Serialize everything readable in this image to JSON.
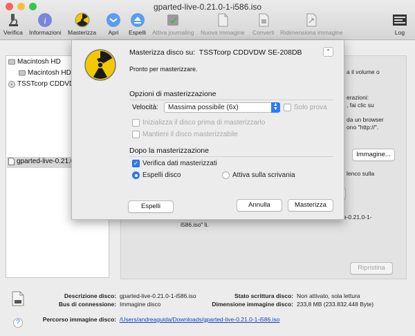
{
  "window": {
    "title": "gparted-live-0.21.0-1-i586.iso"
  },
  "toolbar": {
    "verifica": "Verifica",
    "informazioni": "Informazioni",
    "masterizza": "Masterizza",
    "apri": "Apri",
    "espelli": "Espelli",
    "attiva_journaling": "Attiva journaling",
    "nuova_immagine": "Nuova immagine",
    "converti": "Converti",
    "ridimensiona_immagine": "Ridimensiona immagine",
    "log": "Log",
    "log_icon_text": "WARNI\nMAY 19"
  },
  "sidebar": {
    "items": [
      {
        "label": "Macintosh HD"
      },
      {
        "label": "Macintosh HD"
      },
      {
        "label": "TSSTcorp CDDVD"
      },
      {
        "label": "gparted-live-0.21.0"
      }
    ]
  },
  "background": {
    "line1": "a il volume o",
    "line2": "erazioni:",
    "line3": ", fai clic su",
    "line4": "da un browser",
    "line5": "ono \"http://\".",
    "immagine_button": "Immagine...",
    "line6": "lenco sulla",
    "line7": "e-0.21.0-1-",
    "line8": "i586.iso\" li.",
    "ripristina_button": "Ripristina"
  },
  "info": {
    "descrizione_label": "Descrizione disco:",
    "descrizione_value": "gparted-live-0.21.0-1-i586.iso",
    "bus_label": "Bus di connessione:",
    "bus_value": "Immagine disco",
    "stato_label": "Stato scrittura disco:",
    "stato_value": "Non attivato, sola lettura",
    "dimensione_label": "Dimensione immagine disco:",
    "dimensione_value": "233,8 MB (233.832.448 Byte)",
    "percorso_label": "Percorso immagine disco:",
    "percorso_value": "/Users/andreaguida/Downloads/gparted-live-0.21.0-1-i586.iso",
    "help": "?"
  },
  "sheet": {
    "title_prefix": "Masterizza disco su:",
    "title_device": "TSSTcorp CDDVDW SE-208DB",
    "status": "Pronto per masterizzare.",
    "options_header": "Opzioni di masterizzazione",
    "speed_label": "Velocità:",
    "speed_value": "Massima possibile (6x)",
    "solo_prova": "Solo prova",
    "inizializza": "Inizializza il disco prima di masterizzarlo",
    "mantieni": "Mantieni il disco masterizzabile",
    "after_header": "Dopo la masterizzazione",
    "verifica_dati": "Verifica dati masterizzati",
    "espelli_disco": "Espelli disco",
    "attiva_scrivania": "Attiva sulla scrivania",
    "espelli_button": "Espelli",
    "annulla_button": "Annulla",
    "masterizza_button": "Masterizza"
  },
  "colors": {
    "accent": "#2e7cf6",
    "close": "#fc605c",
    "minimize": "#fdbc40",
    "zoom": "#34c84a"
  }
}
